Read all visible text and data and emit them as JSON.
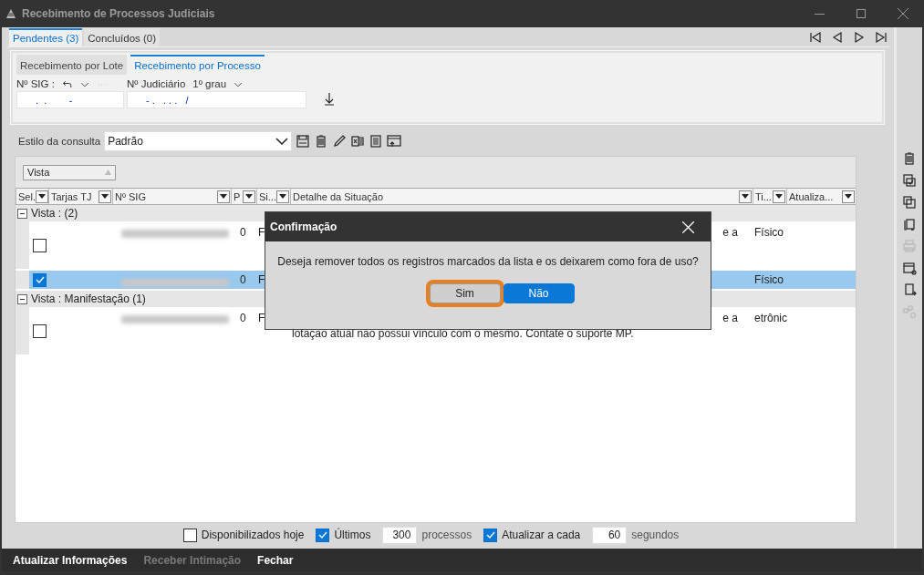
{
  "window": {
    "title": "Recebimento de Processos Judiciais"
  },
  "tabs": [
    {
      "label": "Pendentes (3)",
      "selected": true
    },
    {
      "label": "Concluídos (0)",
      "selected": false
    }
  ],
  "subtabs": [
    {
      "label": "Recebimento por Lote",
      "selected": false
    },
    {
      "label": "Recebimento por Processo",
      "selected": true
    }
  ],
  "filters": {
    "sig_label": "Nº SIG :",
    "sig_value": ".  .        -",
    "judicial_label": "Nº Judiciário",
    "grau": "1º grau",
    "judicial_value": "- .   . . .   /"
  },
  "query_style": {
    "label": "Estilo da consulta",
    "value": "Padrão"
  },
  "grid": {
    "group_by": "Vista",
    "columns": [
      {
        "label": "Sel."
      },
      {
        "label": "Tarjas TJ"
      },
      {
        "label": "Nº SIG"
      },
      {
        "label": "P"
      },
      {
        "label": "Si..."
      },
      {
        "label": "Detalhe da Situação"
      },
      {
        "label": "Ti..."
      },
      {
        "label": "Atualiza..."
      }
    ],
    "groups": [
      {
        "label": "Vista :  (2)",
        "expanded": true,
        "rows": [
          {
            "checked": false,
            "selected": false,
            "p": "0",
            "situacao": "F",
            "detail_end": "e a",
            "tipo": "Físico"
          },
          {
            "checked": true,
            "selected": true,
            "p": "0",
            "situacao": "F",
            "tipo": "Físico"
          }
        ]
      },
      {
        "label": "Vista : Manifestação (1)",
        "expanded": true,
        "rows": [
          {
            "checked": false,
            "selected": false,
            "p": "0",
            "situacao": "F",
            "detail_end": "e a",
            "detail_line": "lotação atual não possui vínculo com o mesmo. Contate o suporte MP.",
            "tipo": "etrônic"
          }
        ]
      }
    ]
  },
  "dialog": {
    "title": "Confirmação",
    "message": "Deseja remover todos os registros marcados da  lista e os deixarem como fora de uso?",
    "buttons": [
      {
        "label": "Sim",
        "focused": true,
        "primary": false
      },
      {
        "label": "Não",
        "focused": false,
        "primary": true
      }
    ]
  },
  "options": [
    {
      "kind": "checkbox",
      "label": "Disponibilizados hoje",
      "checked": false
    },
    {
      "kind": "checkbox",
      "label": "Últimos",
      "checked": true
    },
    {
      "kind": "field",
      "value": "300"
    },
    {
      "kind": "text",
      "label": "processos"
    },
    {
      "kind": "checkbox",
      "label": "Atualizar a cada",
      "checked": true
    },
    {
      "kind": "field",
      "value": "60"
    },
    {
      "kind": "text",
      "label": "segundos"
    }
  ],
  "footer": [
    {
      "label": "Atualizar Informações",
      "disabled": false
    },
    {
      "label": "Receber Intimação",
      "disabled": true
    },
    {
      "label": "Fechar",
      "disabled": false
    }
  ],
  "tools": [
    {
      "disabled": false
    },
    {
      "disabled": false
    },
    {
      "disabled": false
    },
    {
      "disabled": false
    },
    {
      "disabled": true
    },
    {
      "disabled": false
    },
    {
      "disabled": false
    },
    {
      "disabled": true
    }
  ]
}
